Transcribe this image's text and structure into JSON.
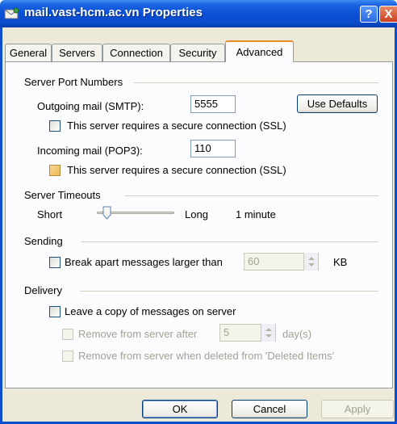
{
  "window": {
    "title": "mail.vast-hcm.ac.vn Properties",
    "help": "?",
    "close": "X"
  },
  "tabs": [
    {
      "label": "General"
    },
    {
      "label": "Servers"
    },
    {
      "label": "Connection"
    },
    {
      "label": "Security"
    },
    {
      "label": "Advanced",
      "active": true
    }
  ],
  "ports": {
    "heading": "Server Port Numbers",
    "outgoing_label": "Outgoing mail (SMTP):",
    "outgoing_value": "5555",
    "use_defaults": "Use Defaults",
    "ssl_outgoing": "This server requires a secure connection (SSL)",
    "incoming_label": "Incoming mail (POP3):",
    "incoming_value": "110",
    "ssl_incoming": "This server requires a secure connection (SSL)"
  },
  "timeouts": {
    "heading": "Server Timeouts",
    "short": "Short",
    "long": "Long",
    "value_text": "1 minute",
    "level": 0.08
  },
  "sending": {
    "heading": "Sending",
    "break_apart": "Break apart messages larger than",
    "size_value": "60",
    "unit": "KB"
  },
  "delivery": {
    "heading": "Delivery",
    "leave_copy": "Leave a copy of messages on server",
    "remove_after": "Remove from server after",
    "days_value": "5",
    "days_unit": "day(s)",
    "remove_deleted": "Remove from server when deleted from 'Deleted Items'"
  },
  "footer": {
    "ok": "OK",
    "cancel": "Cancel",
    "apply": "Apply"
  },
  "colors": {
    "titlebar": "#0a4fd4",
    "dialog": "#ece9d8",
    "panel": "#fcfcfe",
    "active_tab_accent": "#e68b2c"
  }
}
